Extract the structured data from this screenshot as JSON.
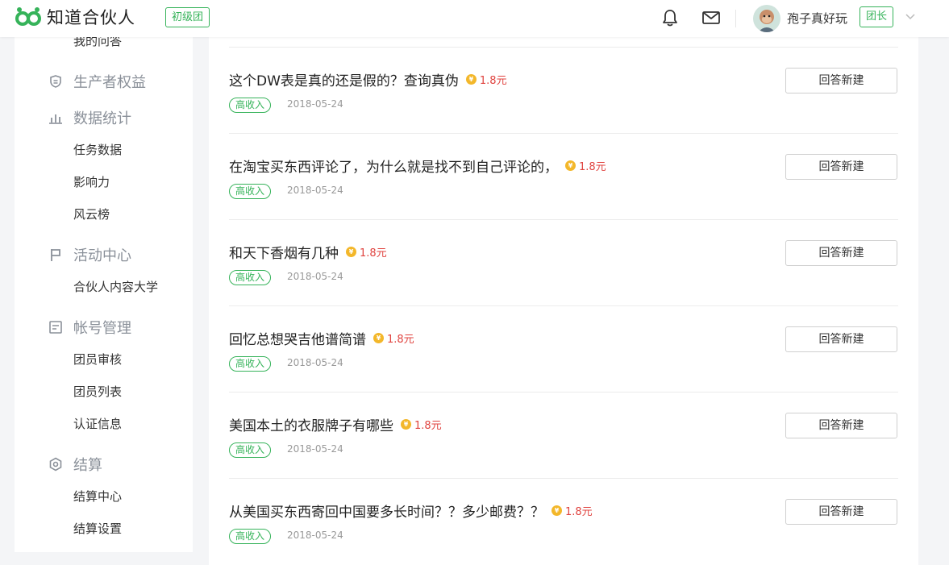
{
  "header": {
    "logo_text": "知道合伙人",
    "level_badge": "初级团",
    "username": "孢子真好玩",
    "role_badge": "团长",
    "icons": [
      "logo-icon",
      "bell-icon",
      "mail-icon",
      "avatar",
      "chevron-down-icon"
    ],
    "brand_color": "#36b35a"
  },
  "sidebar": {
    "items": [
      {
        "kind": "sub",
        "label": "我的问答"
      },
      {
        "kind": "group",
        "label": "生产者权益",
        "icon": "shield-icon"
      },
      {
        "kind": "group",
        "label": "数据统计",
        "icon": "bar-chart-icon"
      },
      {
        "kind": "sub",
        "label": "任务数据"
      },
      {
        "kind": "sub",
        "label": "影响力"
      },
      {
        "kind": "sub",
        "label": "风云榜"
      },
      {
        "kind": "group",
        "label": "活动中心",
        "icon": "flag-icon"
      },
      {
        "kind": "sub",
        "label": "合伙人内容大学"
      },
      {
        "kind": "group",
        "label": "帐号管理",
        "icon": "account-card-icon"
      },
      {
        "kind": "sub",
        "label": "团员审核"
      },
      {
        "kind": "sub",
        "label": "团员列表"
      },
      {
        "kind": "sub",
        "label": "认证信息"
      },
      {
        "kind": "group",
        "label": "结算",
        "icon": "hexagon-settle-icon"
      },
      {
        "kind": "sub",
        "label": "结算中心"
      },
      {
        "kind": "sub",
        "label": "结算设置"
      }
    ]
  },
  "questions": [
    {
      "title": "这个DW表是真的还是假的？查询真伪",
      "reward": "1.8元",
      "tag": "高收入",
      "date": "2018-05-24",
      "button": "回答新建"
    },
    {
      "title": "在淘宝买东西评论了，为什么就是找不到自己评论的，",
      "reward": "1.8元",
      "tag": "高收入",
      "date": "2018-05-24",
      "button": "回答新建"
    },
    {
      "title": "和天下香烟有几种",
      "reward": "1.8元",
      "tag": "高收入",
      "date": "2018-05-24",
      "button": "回答新建"
    },
    {
      "title": "回忆总想哭吉他谱简谱",
      "reward": "1.8元",
      "tag": "高收入",
      "date": "2018-05-24",
      "button": "回答新建"
    },
    {
      "title": "美国本土的衣服牌子有哪些",
      "reward": "1.8元",
      "tag": "高收入",
      "date": "2018-05-24",
      "button": "回答新建"
    },
    {
      "title": "从美国买东西寄回中国要多长时间？？多少邮费？？",
      "reward": "1.8元",
      "tag": "高收入",
      "date": "2018-05-24",
      "button": "回答新建"
    }
  ]
}
